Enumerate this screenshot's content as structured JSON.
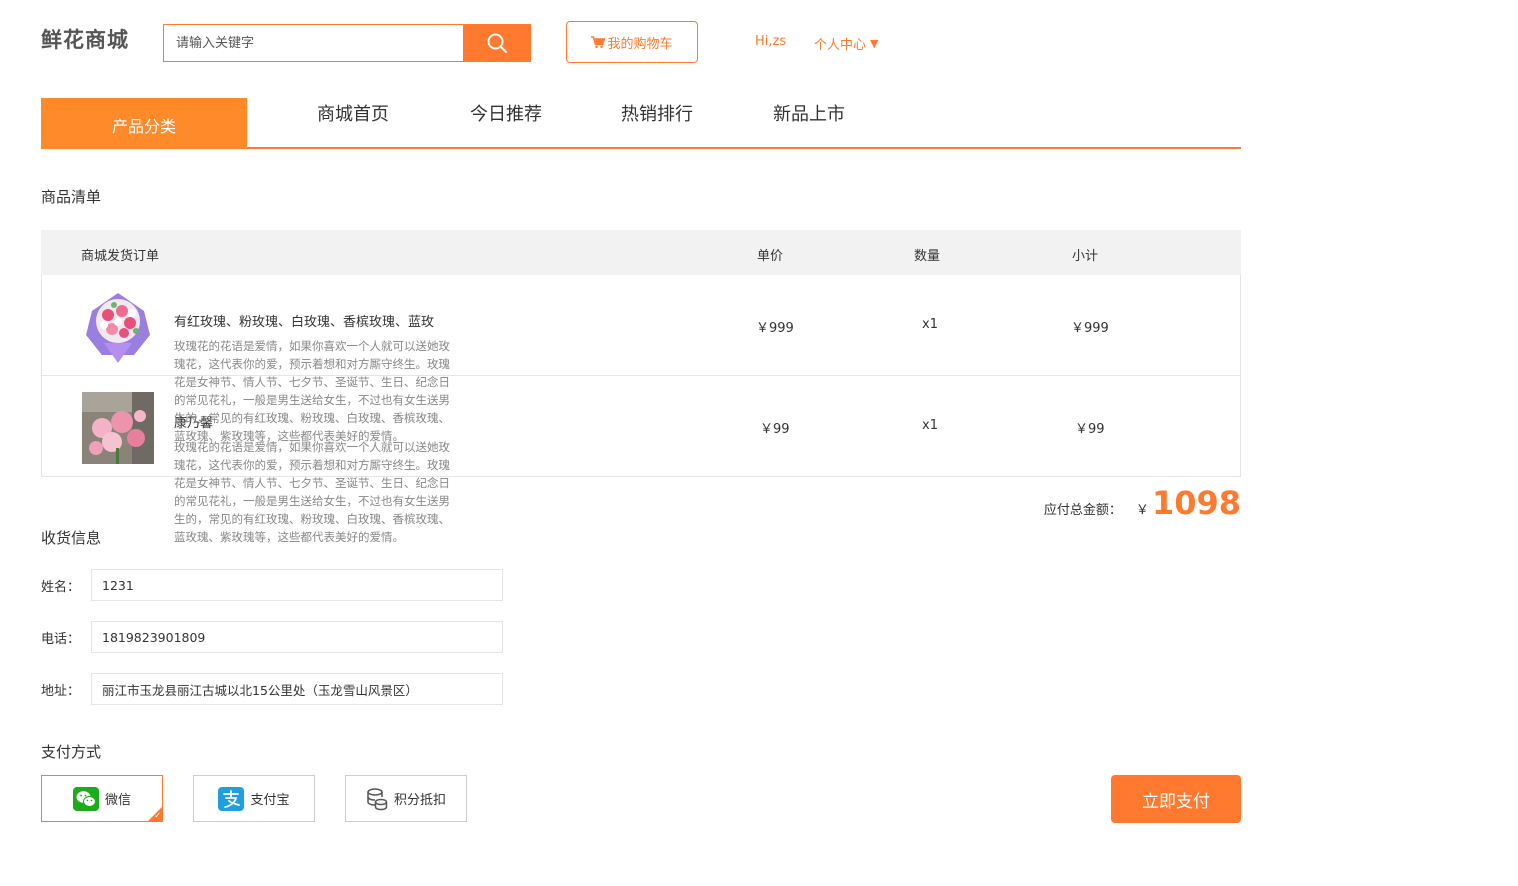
{
  "header": {
    "logo": "鲜花商城",
    "search_placeholder": "请输入关键字",
    "cart_label": "我的购物车",
    "greeting": "Hi,zs",
    "user_center": "个人中心",
    "user_center_caret": "▼"
  },
  "nav": {
    "category": "产品分类",
    "links": [
      "商城首页",
      "今日推荐",
      "热销排行",
      "新品上市"
    ]
  },
  "order": {
    "section_title": "商品清单",
    "headers": {
      "order": "商城发货订单",
      "price": "单价",
      "qty": "数量",
      "subtotal": "小计"
    },
    "items": [
      {
        "name": "有红玫瑰、粉玫瑰、白玫瑰、香槟玫瑰、蓝玫",
        "desc": "玫瑰花的花语是爱情，如果你喜欢一个人就可以送她玫瑰花，这代表你的爱，预示着想和对方厮守终生。玫瑰花是女神节、情人节、七夕节、圣诞节、生日、纪念日的常见花礼，一般是男生送给女生，不过也有女生送男生的，常见的有红玫瑰、粉玫瑰、白玫瑰、香槟玫瑰、蓝玫瑰、紫玫瑰等，这些都代表美好的爱情。",
        "price": "￥999",
        "qty": "x1",
        "subtotal": "￥999"
      },
      {
        "name": "康乃馨",
        "desc": "玫瑰花的花语是爱情，如果你喜欢一个人就可以送她玫瑰花，这代表你的爱，预示着想和对方厮守终生。玫瑰花是女神节、情人节、七夕节、圣诞节、生日、纪念日的常见花礼，一般是男生送给女生，不过也有女生送男生的，常见的有红玫瑰、粉玫瑰、白玫瑰、香槟玫瑰、蓝玫瑰、紫玫瑰等，这些都代表美好的爱情。",
        "price": "￥99",
        "qty": "x1",
        "subtotal": "￥99"
      }
    ],
    "total_label": "应付总金额：",
    "total_currency": "￥",
    "total_amount": "1098"
  },
  "shipping": {
    "section_title": "收货信息",
    "name_label": "姓名：",
    "name_value": "1231",
    "phone_label": "电话：",
    "phone_value": "1819823901809",
    "address_label": "地址：",
    "address_value": "丽江市玉龙县丽江古城以北15公里处（玉龙雪山风景区）"
  },
  "payment": {
    "section_title": "支付方式",
    "options": [
      {
        "label": "微信",
        "icon": "wechat-icon",
        "selected": true
      },
      {
        "label": "支付宝",
        "icon": "alipay-icon",
        "selected": false
      },
      {
        "label": "积分抵扣",
        "icon": "coins-icon",
        "selected": false
      }
    ],
    "pay_button": "立即支付",
    "check_mark": "✓"
  },
  "colors": {
    "accent": "#ff7a2e",
    "nav_active": "#ff8a2a",
    "wechat": "#1aad19",
    "alipay": "#1e9fe0"
  }
}
